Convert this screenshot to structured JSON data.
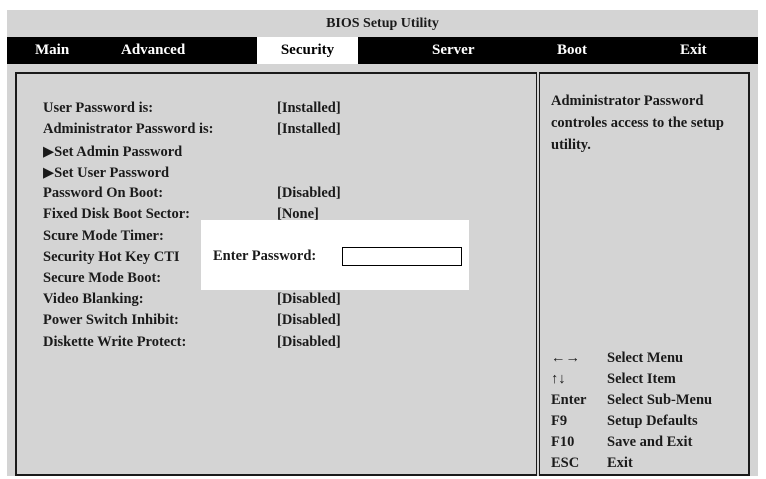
{
  "title": "BIOS Setup Utility",
  "menus": [
    {
      "label": "Main"
    },
    {
      "label": "Advanced"
    },
    {
      "label": "Security"
    },
    {
      "label": "Server"
    },
    {
      "label": "Boot"
    },
    {
      "label": "Exit"
    }
  ],
  "active_menu": "Security",
  "items": [
    {
      "label": "User Password is:",
      "value": "[Installed]"
    },
    {
      "label": "Administrator Password is:",
      "value": "[Installed]"
    },
    {
      "label": "▶Set Admin Password",
      "value": ""
    },
    {
      "label": "▶Set User Password",
      "value": ""
    },
    {
      "label": "Password On Boot:",
      "value": "[Disabled]"
    },
    {
      "label": "Fixed Disk Boot Sector:",
      "value": "[None]"
    },
    {
      "label": "Scure Mode Timer:",
      "value": ""
    },
    {
      "label": "Security Hot Key CTI",
      "value": ""
    },
    {
      "label": "Secure Mode Boot:",
      "value": ""
    },
    {
      "label": "Video Blanking:",
      "value": "[Disabled]"
    },
    {
      "label": "Power Switch Inhibit:",
      "value": "[Disabled]"
    },
    {
      "label": "Diskette Write Protect:",
      "value": "[Disabled]"
    }
  ],
  "help": {
    "text": "Administrator Password controles access to the setup utility."
  },
  "keys": [
    {
      "key": "←→",
      "desc": "Select Menu"
    },
    {
      "key": "↑↓",
      "desc": "Select Item"
    },
    {
      "key": "Enter",
      "desc": "Select Sub-Menu"
    },
    {
      "key": "F9",
      "desc": "Setup Defaults"
    },
    {
      "key": "F10",
      "desc": "Save and Exit"
    },
    {
      "key": "ESC",
      "desc": "Exit"
    }
  ],
  "dialog": {
    "label": "Enter Password:",
    "value": ""
  },
  "colors": {
    "panel": "#d4d4d4",
    "menubar": "#000000",
    "text": "#1a1a1a"
  }
}
